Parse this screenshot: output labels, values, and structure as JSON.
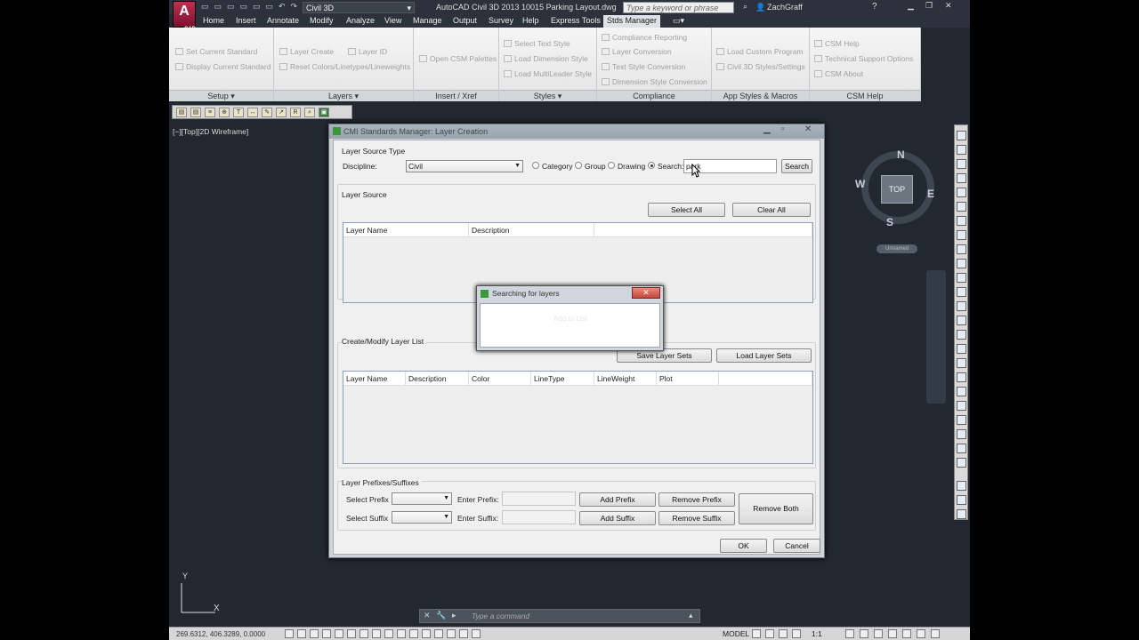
{
  "app": {
    "logo": "A",
    "logo_sub": "CAD",
    "workspace": "Civil 3D",
    "title": "AutoCAD Civil 3D 2013     10015 Parking Layout.dwg",
    "search_placeholder": "Type a keyword or phrase",
    "user": "ZachGraff"
  },
  "menu": [
    "Home",
    "Insert",
    "Annotate",
    "Modify",
    "Analyze",
    "View",
    "Manage",
    "Output",
    "Survey",
    "Help",
    "Express Tools",
    "Stds Manager"
  ],
  "ribbon": {
    "setup": {
      "items": [
        "Set Current Standard",
        "Display Current Standard"
      ],
      "caption": "Setup ▾"
    },
    "layers": {
      "items": [
        "Layer Create",
        "Layer ID",
        "Reset Colors/Linetypes/Lineweights"
      ],
      "caption": "Layers ▾"
    },
    "insert": {
      "items": [
        "Open CSM Palettes"
      ],
      "caption": "Insert / Xref"
    },
    "styles": {
      "items": [
        "Select Text Style",
        "Load Dimension Style",
        "Load MultiLeader Style"
      ],
      "caption": "Styles ▾"
    },
    "compliance": {
      "items": [
        "Compliance Reporting",
        "Layer Conversion",
        "Text Style Conversion",
        "Dimension Style Conversion"
      ],
      "caption": "Compliance"
    },
    "appstyles": {
      "items": [
        "Load Custom Program",
        "Civil 3D Styles/Settings"
      ],
      "caption": "App Styles & Macros"
    },
    "help": {
      "items": [
        "CSM Help",
        "Technical Support Options",
        "CSM About"
      ],
      "caption": "CSM Help"
    }
  },
  "viewport": {
    "label": "[−][Top][2D Wireframe]",
    "cube": "TOP",
    "n": "N",
    "s": "S",
    "e": "E",
    "w": "W",
    "ucs": "Unnamed",
    "axis_y": "Y",
    "axis_x": "X"
  },
  "dialog": {
    "title": "CMI Standards Manager: Layer Creation",
    "source_type_label": "Layer Source Type",
    "discipline_label": "Discipline:",
    "discipline_value": "Civil",
    "radios": [
      "Category",
      "Group",
      "Drawing",
      "Search:"
    ],
    "search_value": "park",
    "search_button": "Search",
    "layer_source_label": "Layer Source",
    "select_all": "Select All",
    "clear_all": "Clear All",
    "source_cols": [
      "Layer Name",
      "Description"
    ],
    "create_label": "Create/Modify Layer List",
    "save_sets": "Save Layer Sets",
    "load_sets": "Load Layer Sets",
    "list_cols": [
      "Layer Name",
      "Description",
      "Color",
      "LineType",
      "LineWeight",
      "Plot"
    ],
    "prefix_label": "Layer Prefixes/Suffixes",
    "select_prefix": "Select Prefix",
    "select_suffix": "Select Suffix",
    "enter_prefix": "Enter Prefix:",
    "enter_suffix": "Enter Suffix:",
    "add_prefix": "Add Prefix",
    "add_suffix": "Add Suffix",
    "remove_prefix": "Remove Prefix",
    "remove_suffix": "Remove Suffix",
    "remove_both": "Remove Both",
    "ok": "OK",
    "cancel": "Cancel"
  },
  "popup": {
    "title": "Searching for layers",
    "ghost": "Add to List",
    "close": "✕"
  },
  "command": {
    "placeholder": "Type a command"
  },
  "status": {
    "coords": "269.6312, 406.3289, 0.0000",
    "model": "MODEL",
    "scale": "1:1"
  }
}
